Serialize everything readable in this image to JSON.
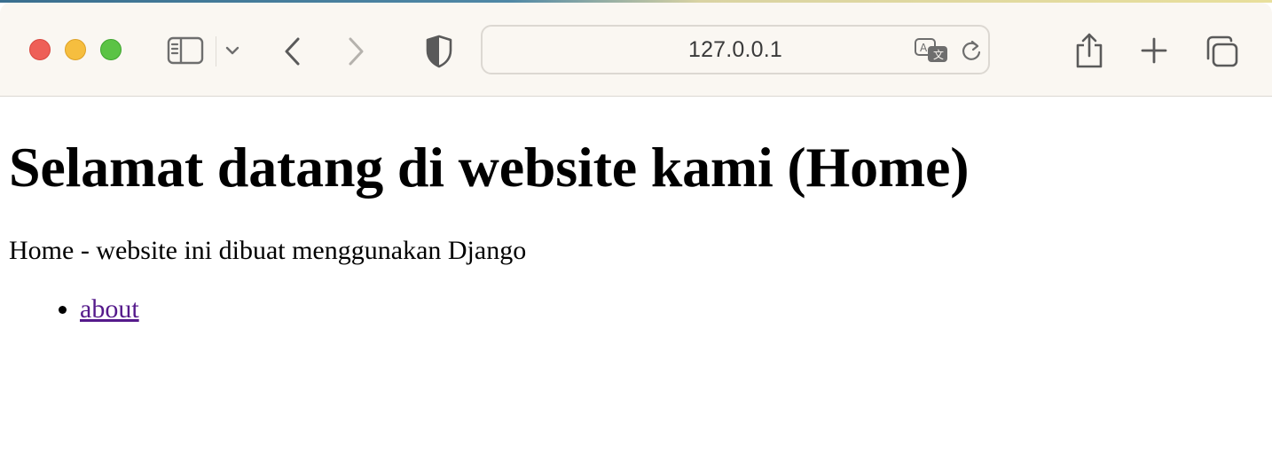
{
  "browser": {
    "address": "127.0.0.1",
    "icons": {
      "sidebar": "sidebar-icon",
      "tab_overview_chevron": "chevron-down-icon",
      "back": "chevron-left-icon",
      "forward": "chevron-right-icon",
      "privacy": "shield-icon",
      "translate": "translate-icon",
      "reload": "reload-icon",
      "share": "share-icon",
      "new_tab": "plus-icon",
      "tabs": "tabs-overview-icon"
    },
    "colors": {
      "close": "#ee5f57",
      "minimize": "#f6be3f",
      "maximize": "#5bc345",
      "toolbar": "#faf7f2"
    }
  },
  "page": {
    "heading": "Selamat datang di website kami (Home)",
    "description": "Home - website ini dibuat menggunakan Django",
    "links": [
      {
        "label": "about",
        "color": "#551a8b"
      }
    ]
  }
}
